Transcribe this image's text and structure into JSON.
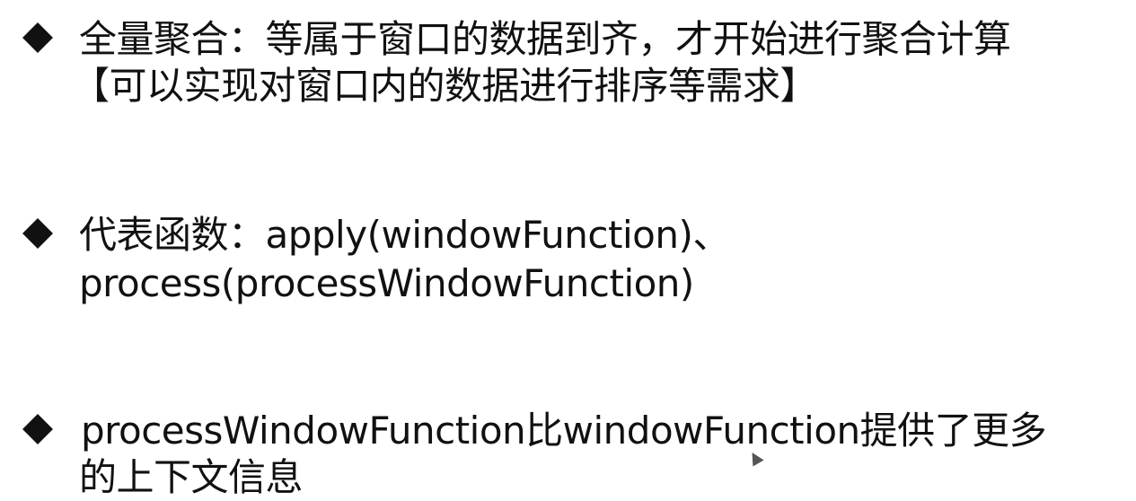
{
  "bullets": [
    {
      "lines": [
        "全量聚合：等属于窗口的数据到齐，才开始进行聚合计算",
        "【可以实现对窗口内的数据进行排序等需求】"
      ]
    },
    {
      "lines": [
        "代表函数：apply(windowFunction)、",
        "process(processWindowFunction)"
      ]
    },
    {
      "lines": [
        "processWindowFunction比windowFunction提供了更多",
        "的上下文信息"
      ]
    }
  ]
}
